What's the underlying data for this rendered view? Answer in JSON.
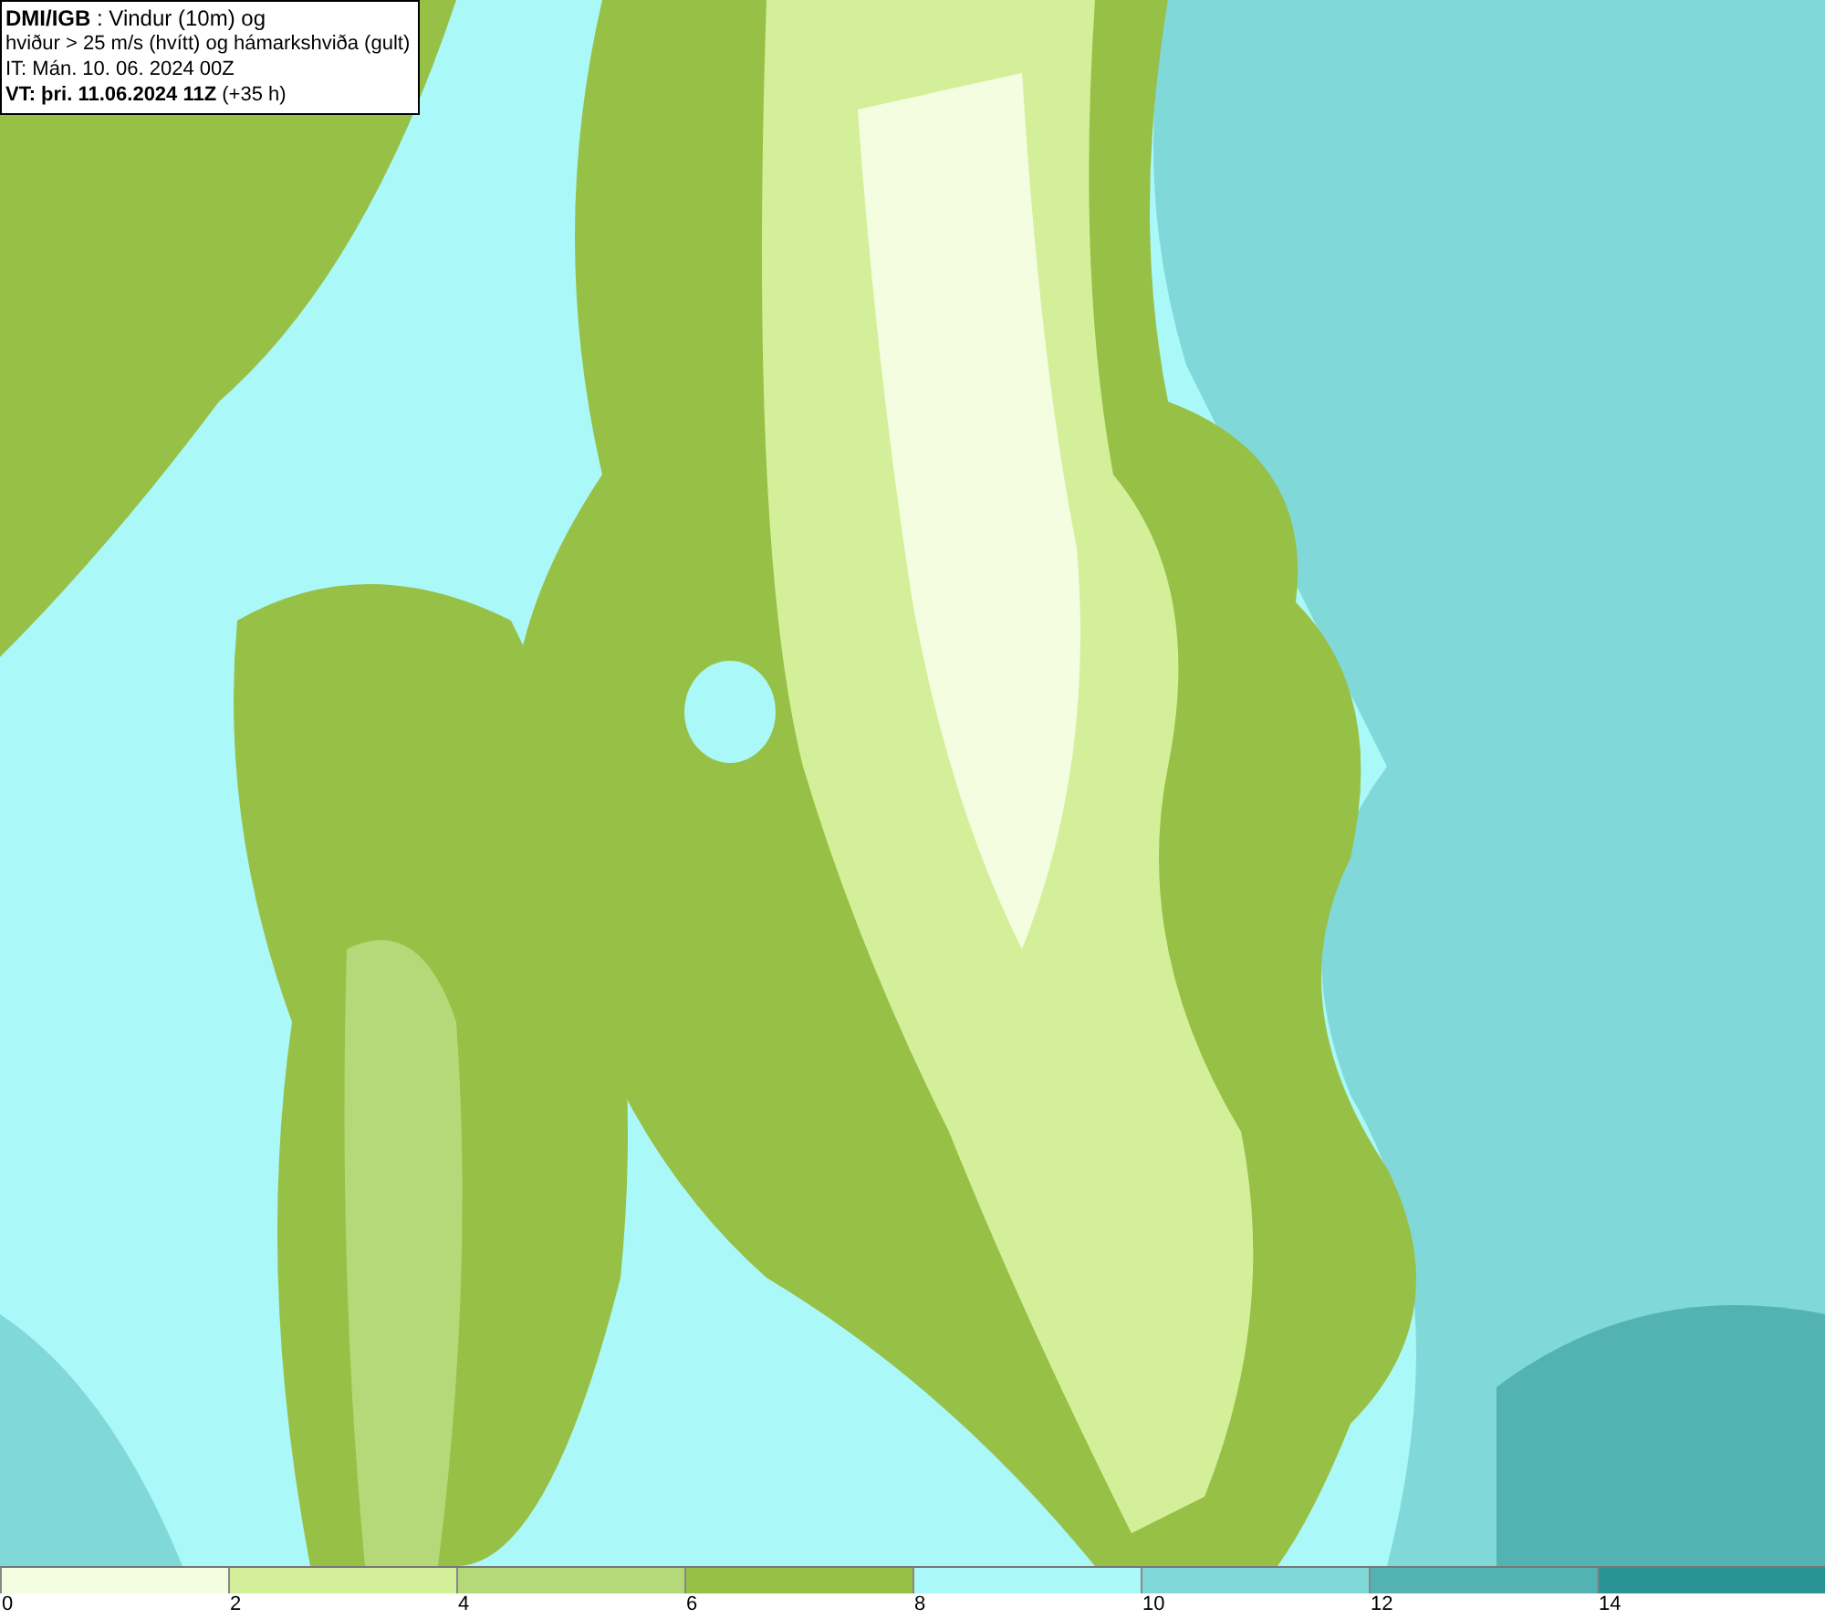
{
  "title_box": {
    "lines": [
      "**DMI/IGB** : Vindur (10m) og",
      "hviður > 25 m/s (hvítt) og hámarkshviða (gult)",
      "IT: Mán. 10. 06. 2024 00Z",
      "**VT: þri. 11.06.2024 11Z** (+35 h)"
    ]
  },
  "legend": [
    {
      "color": "#f5fde0",
      "label": "0"
    },
    {
      "color": "#d4ef9a",
      "label": "2"
    },
    {
      "color": "#b5d978",
      "label": "4"
    },
    {
      "color": "#97c046",
      "label": "6"
    },
    {
      "color": "#aaf8f8",
      "label": "8"
    },
    {
      "color": "#80d8d8",
      "label": "10"
    },
    {
      "color": "#53b3b3",
      "label": "12"
    },
    {
      "color": "#2a9494",
      "label": "14"
    }
  ]
}
